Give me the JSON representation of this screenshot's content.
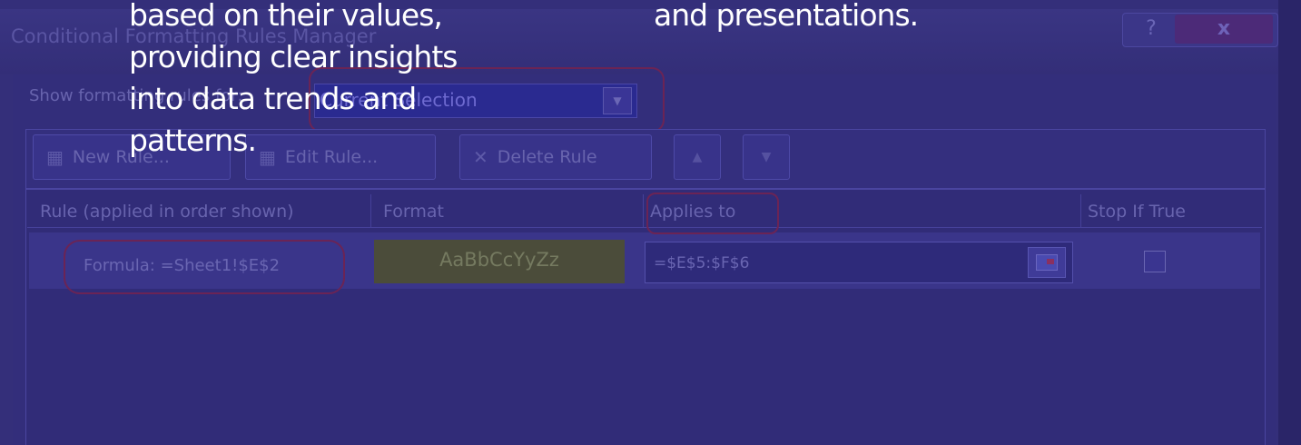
{
  "dialog": {
    "title": "Conditional Formatting Rules Manager",
    "help_label": "?",
    "close_label": "x"
  },
  "show_rules": {
    "label": "Show formatting rules for:",
    "value": "Current Selection",
    "dropdown_icon": "chevron-down-icon"
  },
  "toolbar": {
    "new_rule": "New Rule...",
    "edit_rule": "Edit Rule...",
    "delete_rule": "Delete Rule",
    "move_up_icon": "triangle-up-icon",
    "move_down_icon": "triangle-down-icon"
  },
  "table": {
    "columns": [
      "Rule (applied in order shown)",
      "Format",
      "Applies to",
      "Stop If True"
    ],
    "rows": [
      {
        "rule": "Formula: =Sheet1!$E$2",
        "format_preview": "AaBbCcYyZz",
        "applies_to": "=$E$5:$F$6",
        "stop_if_true": false
      }
    ]
  },
  "overlay": {
    "left_lines": [
      "based on their values,",
      "providing clear insights",
      "into data trends and",
      "patterns."
    ],
    "right_lines": [
      "and presentations."
    ]
  },
  "colors": {
    "overlay_tint": "#2f2a72",
    "highlight_oval": "#6b2455",
    "format_preview_bg": "#4b4c3a"
  }
}
